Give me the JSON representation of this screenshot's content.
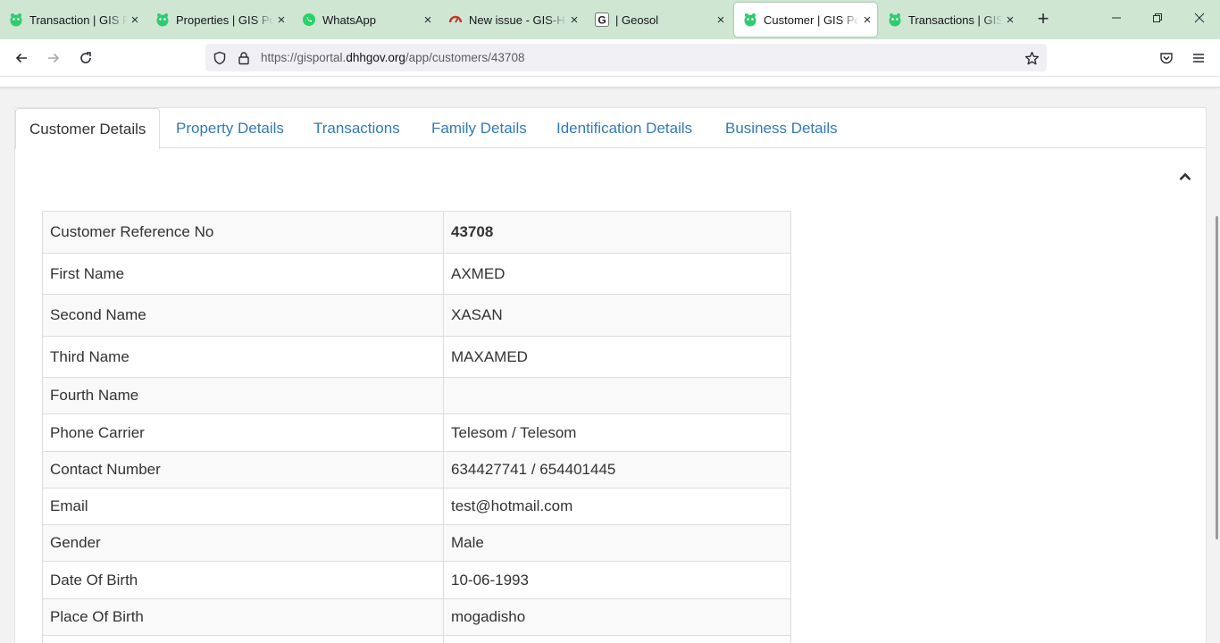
{
  "browser": {
    "tabs": [
      {
        "title": "Transaction | GIS Portal",
        "icon": "gis-portal-icon",
        "active": false
      },
      {
        "title": "Properties | GIS Portal",
        "icon": "gis-portal-icon",
        "active": false
      },
      {
        "title": "WhatsApp",
        "icon": "whatsapp-icon",
        "active": false
      },
      {
        "title": "New issue - GIS-Hargeisa",
        "icon": "gitlab-icon",
        "active": false
      },
      {
        "title": "| Geosol",
        "icon": "geosol-icon",
        "active": false
      },
      {
        "title": "Customer | GIS Portal",
        "icon": "gis-portal-icon",
        "active": true
      },
      {
        "title": "Transactions | GIS Portal",
        "icon": "gis-portal-icon",
        "active": false
      }
    ],
    "url_prefix": "https://gisportal.",
    "url_domain": "dhhgov.org",
    "url_path": "/app/customers/43708"
  },
  "page": {
    "tabs": [
      {
        "label": "Customer Details",
        "active": true
      },
      {
        "label": "Property Details",
        "active": false
      },
      {
        "label": "Transactions",
        "active": false
      },
      {
        "label": "Family Details",
        "active": false
      },
      {
        "label": "Identification Details",
        "active": false
      },
      {
        "label": "Business Details",
        "active": false
      }
    ],
    "details": [
      {
        "label": "Customer Reference No",
        "value": "43708"
      },
      {
        "label": "First Name",
        "value": "AXMED"
      },
      {
        "label": "Second Name",
        "value": "XASAN"
      },
      {
        "label": "Third Name",
        "value": "MAXAMED"
      },
      {
        "label": "Fourth Name",
        "value": ""
      },
      {
        "label": "Phone Carrier",
        "value": "Telesom / Telesom"
      },
      {
        "label": "Contact Number",
        "value": "634427741 / 654401445"
      },
      {
        "label": "Email",
        "value": "test@hotmail.com"
      },
      {
        "label": "Gender",
        "value": "Male"
      },
      {
        "label": "Date Of Birth",
        "value": "10-06-1993"
      },
      {
        "label": "Place Of Birth",
        "value": "mogadisho"
      }
    ]
  },
  "colors": {
    "tabstrip_bg": "#cfe6d3",
    "link": "#337ab7",
    "gis_green": "#2ecc71",
    "whatsapp_green": "#25d366",
    "gitlab_red": "#c0392b"
  }
}
